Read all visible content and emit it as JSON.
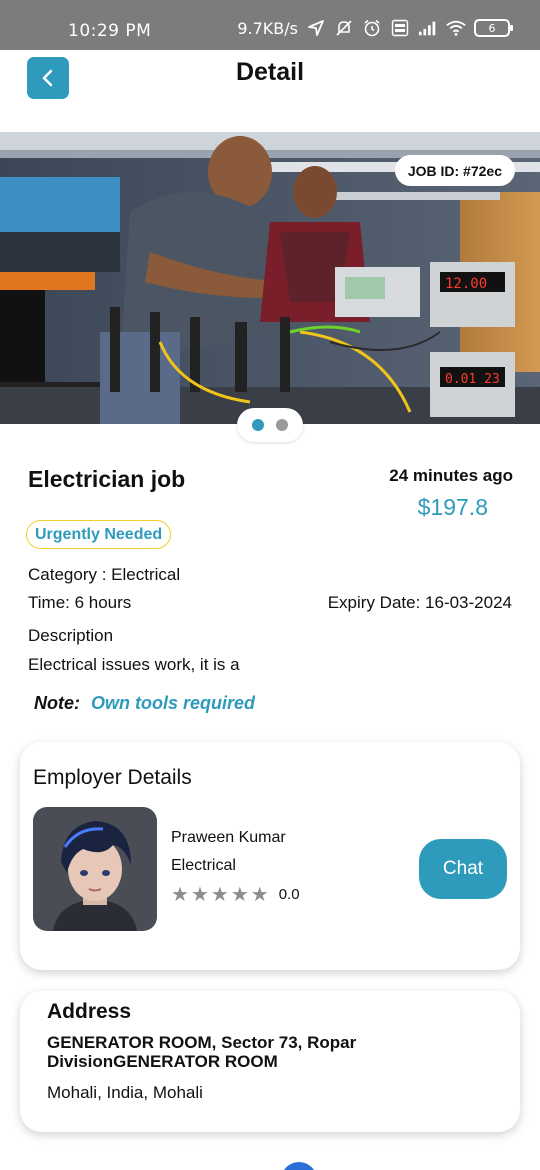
{
  "status_bar": {
    "time": "10:29 PM",
    "network_speed": "9.7KB/s",
    "battery_level": "6",
    "icons": [
      "location-arrow-icon",
      "mute-icon",
      "alarm-icon",
      "volte-icon",
      "signal-icon",
      "wifi-icon",
      "battery-icon"
    ]
  },
  "header": {
    "title": "Detail",
    "back_icon": "chevron-left-icon"
  },
  "hero": {
    "job_id": "JOB ID: #72ec",
    "slides": 2,
    "active_slide": 1
  },
  "job": {
    "title": "Electrician job",
    "posted": "24 minutes ago",
    "price": "$197.8",
    "badge": "Urgently Needed",
    "category": "Category : Electrical",
    "time": "Time: 6 hours",
    "expiry": "Expiry Date: 16-03-2024",
    "description_label": "Description",
    "description": "Electrical issues work, it is a",
    "note_label": "Note:",
    "note_value": "Own tools required"
  },
  "employer": {
    "section_title": "Employer Details",
    "name": "Praween Kumar",
    "category": "Electrical",
    "rating": "0.0",
    "stars_filled": 0,
    "stars_total": 5,
    "chat_label": "Chat"
  },
  "address": {
    "title": "Address",
    "line1": "GENERATOR ROOM, Sector 73, Ropar DivisionGENERATOR ROOM",
    "line2": "Mohali, India, Mohali"
  },
  "colors": {
    "accent": "#2f9bbc",
    "badge_border": "#f2cf2c",
    "status_bar": "#7c7c7c",
    "star_empty": "#8d8d8d"
  }
}
